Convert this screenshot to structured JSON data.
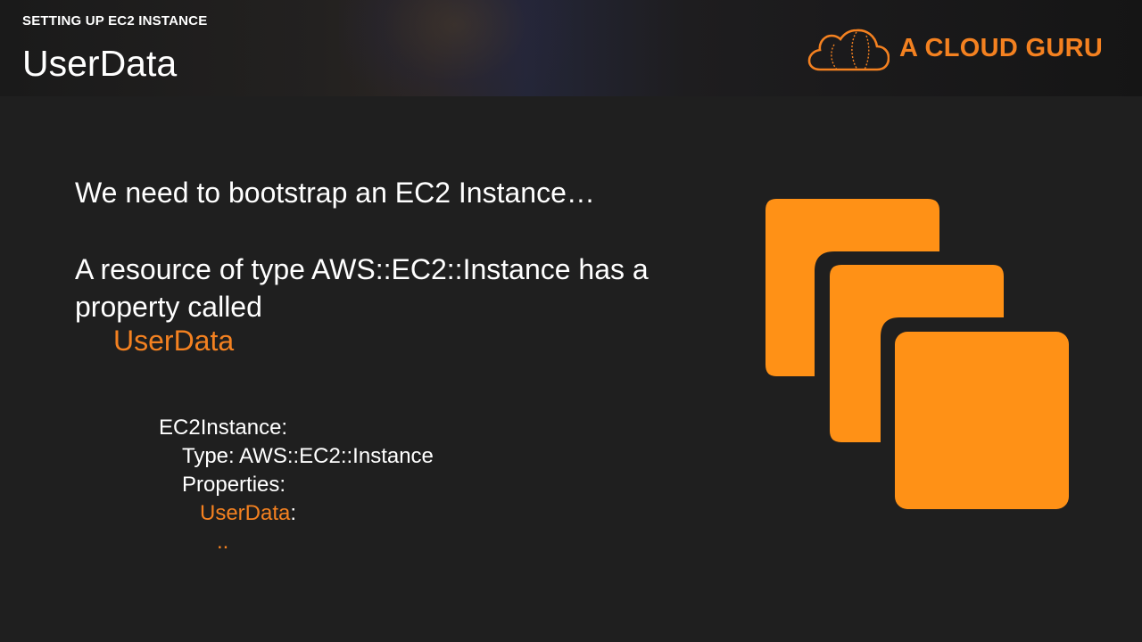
{
  "header": {
    "kicker": "SETTING UP EC2 INSTANCE",
    "title": "UserData",
    "brand": "A CLOUD GURU"
  },
  "content": {
    "line1": "We need to bootstrap an EC2 Instance…",
    "line2": "A resource of type AWS::EC2::Instance has a property called",
    "line3": "UserData"
  },
  "code": {
    "line1": "EC2Instance:",
    "line2": "Type: AWS::EC2::Instance",
    "line3": "Properties:",
    "line4_key": "UserData",
    "line4_colon": ":",
    "line5": ".."
  },
  "icons": {
    "ec2_instances": "ec2-instances-icon",
    "brand_logo": "cloud-logo-icon"
  },
  "colors": {
    "accent": "#f48120",
    "background": "#1f1f1f",
    "icon_orange": "#ff9116"
  }
}
